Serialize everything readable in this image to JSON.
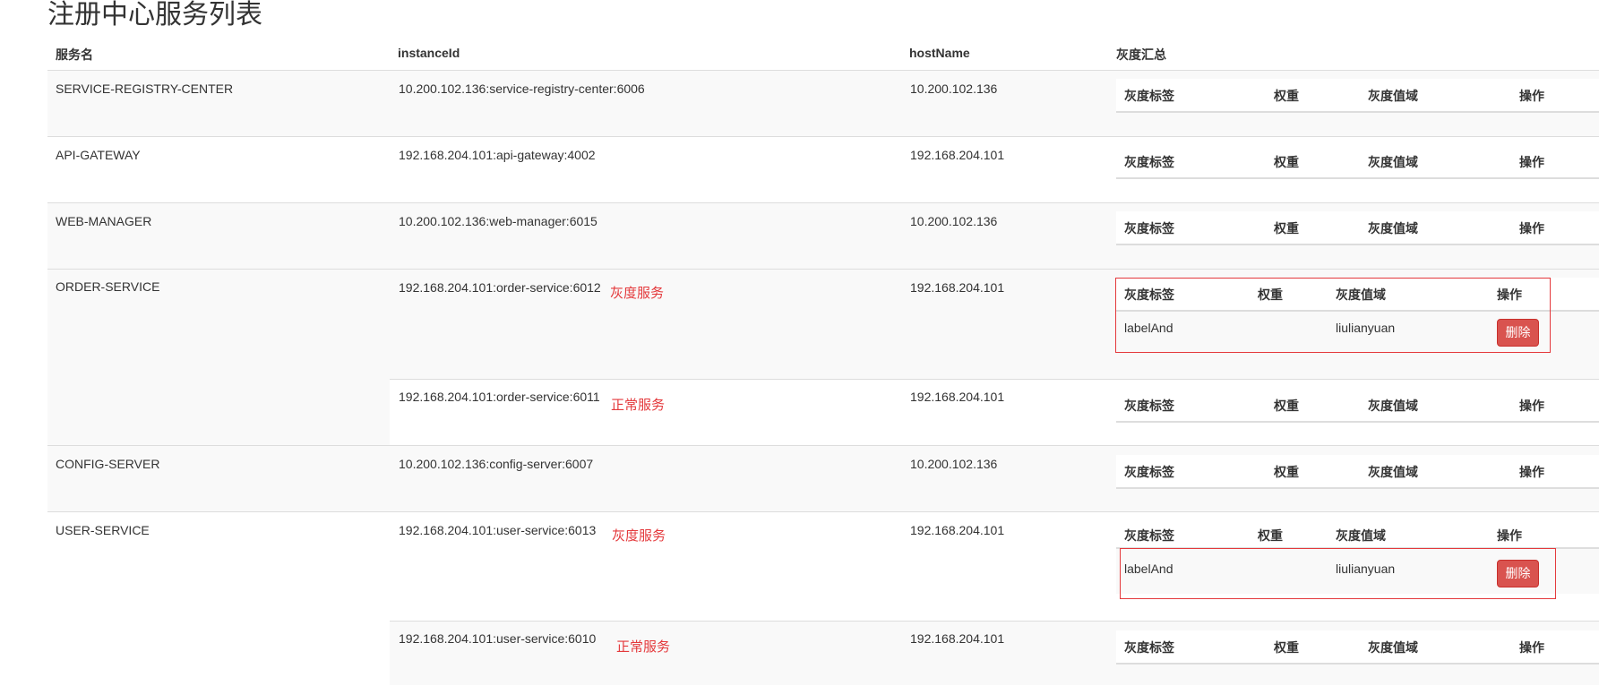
{
  "page": {
    "title": "注册中心服务列表"
  },
  "columns": {
    "service": "服务名",
    "instance": "instanceId",
    "host": "hostName",
    "gray": "灰度汇总"
  },
  "gray_columns": {
    "label": "灰度标签",
    "weight": "权重",
    "range": "灰度值域",
    "action": "操作"
  },
  "rows": [
    {
      "service": "SERVICE-REGISTRY-CENTER",
      "instance": "10.200.102.136:service-registry-center:6006",
      "host": "10.200.102.136"
    },
    {
      "service": "API-GATEWAY",
      "instance": "192.168.204.101:api-gateway:4002",
      "host": "192.168.204.101"
    },
    {
      "service": "WEB-MANAGER",
      "instance": "10.200.102.136:web-manager:6015",
      "host": "10.200.102.136"
    },
    {
      "service": "ORDER-SERVICE",
      "instance": "192.168.204.101:order-service:6012",
      "host": "192.168.204.101",
      "note": "灰度服务",
      "gray": {
        "label": "labelAnd",
        "weight": "",
        "range": "liulianyuan",
        "action": "删除"
      }
    },
    {
      "service": "",
      "instance": "192.168.204.101:order-service:6011",
      "host": "192.168.204.101",
      "note": "正常服务"
    },
    {
      "service": "CONFIG-SERVER",
      "instance": "10.200.102.136:config-server:6007",
      "host": "10.200.102.136"
    },
    {
      "service": "USER-SERVICE",
      "instance": "192.168.204.101:user-service:6013",
      "host": "192.168.204.101",
      "note": "灰度服务",
      "gray": {
        "label": "labelAnd",
        "weight": "",
        "range": "liulianyuan",
        "action": "删除"
      }
    },
    {
      "service": "",
      "instance": "192.168.204.101:user-service:6010",
      "host": "192.168.204.101",
      "note": "正常服务"
    }
  ],
  "colors": {
    "accent_red": "#e4393c",
    "danger_button": "#d9534f",
    "stripe": "#f9f9f9",
    "border": "#dddddd"
  }
}
